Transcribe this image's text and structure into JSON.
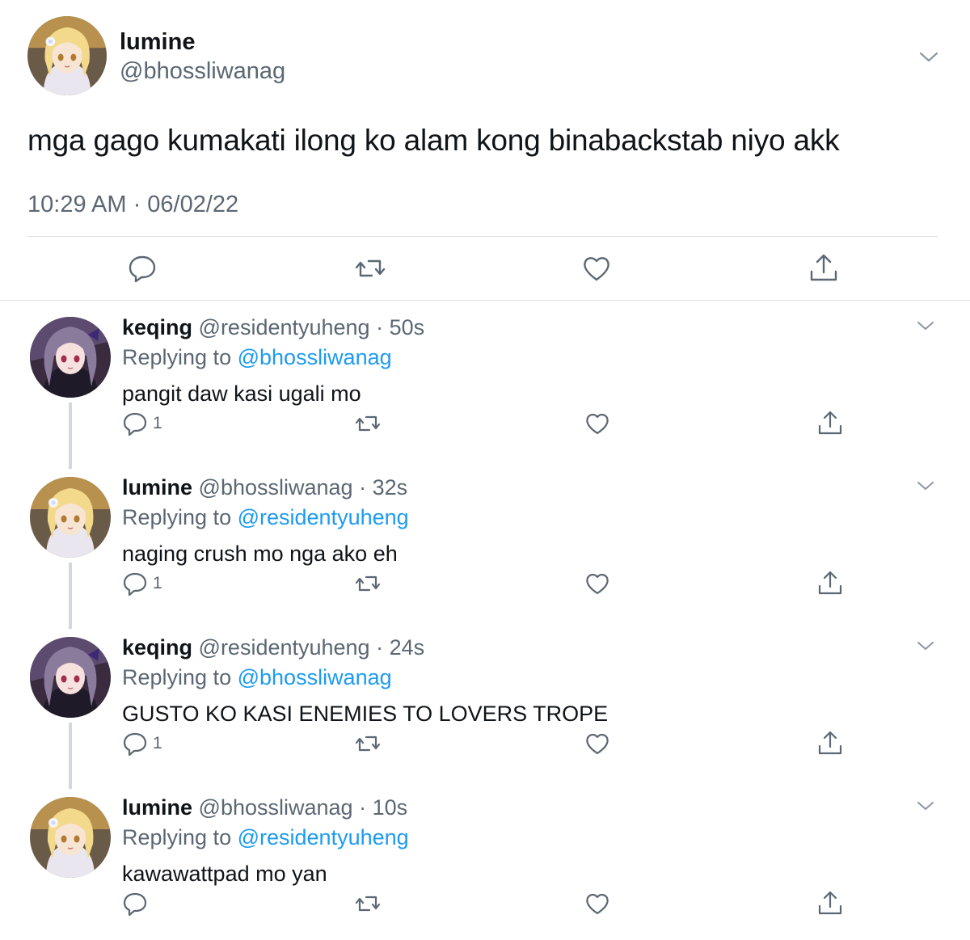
{
  "main_tweet": {
    "name": "lumine",
    "handle": "@bhossliwanag",
    "text": "mga gago kumakati ilong ko alam kong binabackstab niyo akk",
    "timestamp": "10:29 AM · 06/02/22",
    "actions": [
      "reply-icon",
      "retweet-icon",
      "like-icon",
      "share-icon"
    ]
  },
  "replies": [
    {
      "name": "keqing",
      "handle": "@residentyuheng",
      "time": "50s",
      "replying_label": "Replying to",
      "replying_to": "@bhossliwanag",
      "text": "pangit daw kasi ugali mo",
      "reply_count": "1",
      "avatar": "keqing"
    },
    {
      "name": "lumine",
      "handle": "@bhossliwanag",
      "time": "32s",
      "replying_label": "Replying to",
      "replying_to": "@residentyuheng",
      "text": "naging crush mo nga ako eh",
      "reply_count": "1",
      "avatar": "lumine"
    },
    {
      "name": "keqing",
      "handle": "@residentyuheng",
      "time": "24s",
      "replying_label": "Replying to",
      "replying_to": "@bhossliwanag",
      "text": "GUSTO KO KASI ENEMIES TO LOVERS TROPE",
      "reply_count": "1",
      "avatar": "keqing"
    },
    {
      "name": "lumine",
      "handle": "@bhossliwanag",
      "time": "10s",
      "replying_label": "Replying to",
      "replying_to": "@residentyuheng",
      "text": "kawawattpad mo yan",
      "reply_count": "",
      "avatar": "lumine"
    }
  ],
  "colors": {
    "text": "#0f1419",
    "secondary": "#5b6773",
    "link": "#1d9bf0",
    "divider": "#dcdfe3",
    "thread_line": "#cfd9de"
  }
}
